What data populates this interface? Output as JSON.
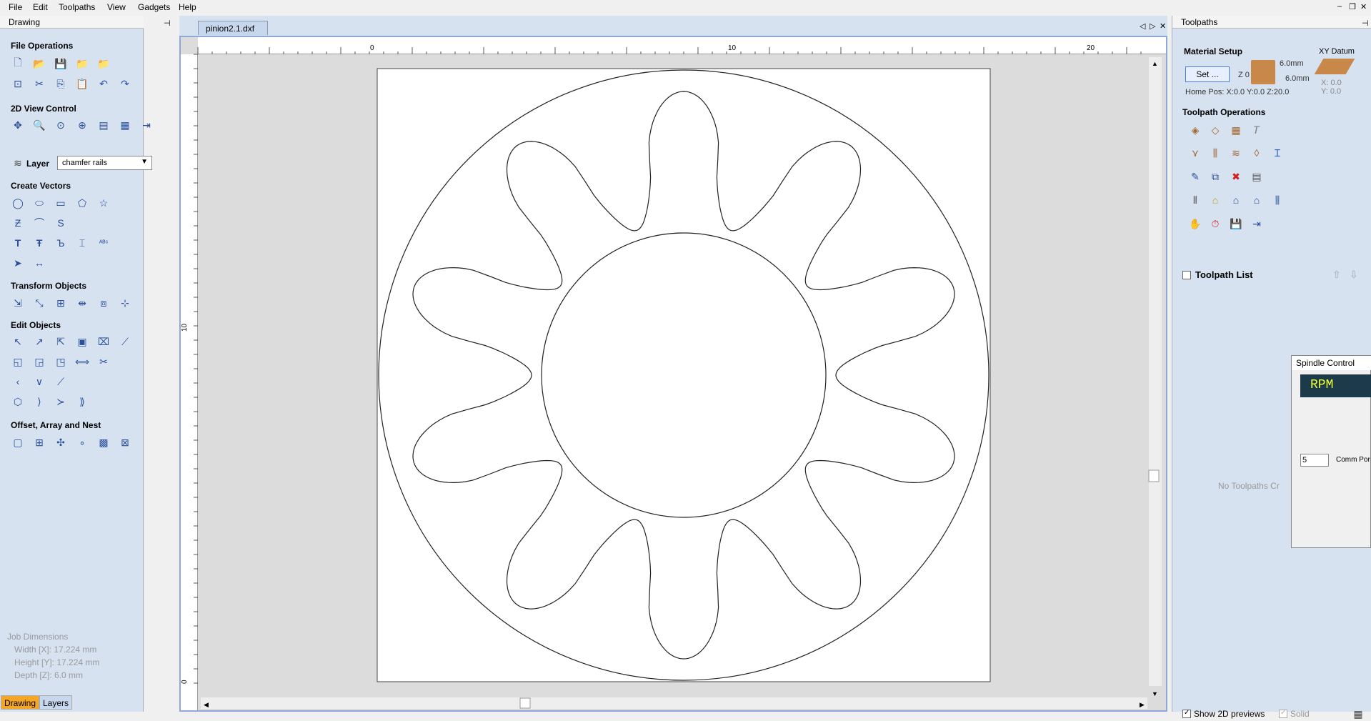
{
  "menu": [
    "File",
    "Edit",
    "Toolpaths",
    "View",
    "Gadgets",
    "Help"
  ],
  "left_panel": {
    "title": "Drawing",
    "sections": {
      "file_ops": "File Operations",
      "view_2d": "2D View Control",
      "create_vectors": "Create Vectors",
      "transform": "Transform Objects",
      "edit": "Edit Objects",
      "offset": "Offset, Array and Nest"
    },
    "layer_label": "Layer",
    "layer_value": "chamfer rails",
    "job_dimensions": {
      "title": "Job Dimensions",
      "width": "Width  [X]: 17.224 mm",
      "height": "Height [Y]: 17.224 mm",
      "depth": "Depth  [Z]: 6.0 mm"
    },
    "tabs": [
      "Drawing",
      "Layers"
    ]
  },
  "document": {
    "tab_title": "pinion2.1.dxf",
    "ruler_top_labels": [
      "0",
      "10",
      "20"
    ],
    "ruler_left_labels": [
      "10",
      "0"
    ]
  },
  "right_panel": {
    "title": "Toolpaths",
    "material_setup": "Material Setup",
    "set_button": "Set ...",
    "z0": "Z 0",
    "thickness_top": "6.0mm",
    "thickness_bottom": "6.0mm",
    "home_pos": "Home Pos:  X:0.0 Y:0.0 Z:20.0",
    "xy_datum": "XY Datum",
    "xy_values": [
      "X: 0.0",
      "Y: 0.0"
    ],
    "toolpath_ops": "Toolpath Operations",
    "toolpath_list": "Toolpath List",
    "no_toolpaths": "No Toolpaths Cr",
    "show_2d": "Show 2D previews",
    "solid": "Solid"
  },
  "spindle": {
    "title": "Spindle Control",
    "rpm": "RPM",
    "comm_value": "5",
    "comm_label": "Comm Por"
  },
  "icons": {
    "file_ops": [
      "new-file-icon",
      "open-icon",
      "save-icon",
      "open-folder-icon",
      "import-icon",
      "select-all-icon",
      "cut-icon",
      "copy-icon",
      "paste-icon",
      "undo-icon",
      "redo-icon"
    ],
    "accent_color": "#2a4f9a"
  }
}
